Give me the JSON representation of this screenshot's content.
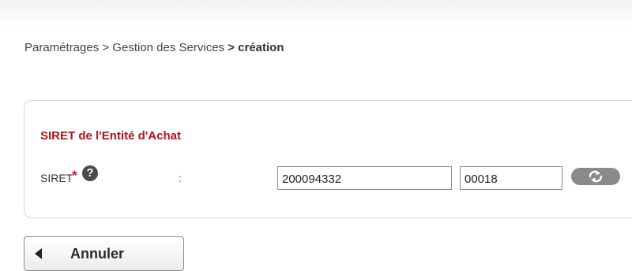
{
  "breadcrumb": {
    "path": "Paramétrages > Gestion des Services",
    "current": "> création"
  },
  "section": {
    "title": "SIRET de l'Entité d'Achat"
  },
  "siret_field": {
    "label": "SIRET",
    "required_marker": "*",
    "help_glyph": "?",
    "separator": ":",
    "siren_value": "200094332",
    "nic_value": "00018"
  },
  "icons": {
    "help": "question-circle-icon",
    "refresh": "refresh-arrows-icon",
    "back": "left-arrow-icon"
  },
  "actions": {
    "cancel_label": "Annuler"
  },
  "colors": {
    "section_title": "#b3121b",
    "required_star": "#d8111c",
    "refresh_button": "#8a8a8a"
  }
}
